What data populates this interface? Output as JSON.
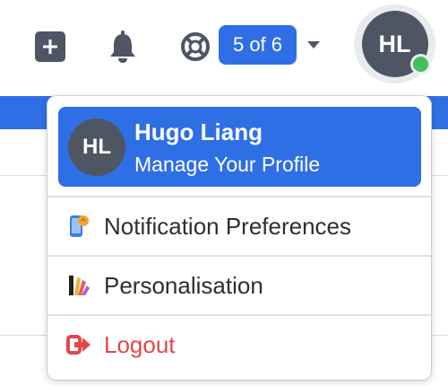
{
  "toolbar": {
    "add_icon": "plus-square-icon",
    "bell_icon": "bell-icon",
    "help_icon": "lifebuoy-icon",
    "counter_label": "5 of 6",
    "caret_icon": "caret-down-icon"
  },
  "user": {
    "initials": "HL",
    "status": "online",
    "status_color": "#42c05a"
  },
  "dropdown": {
    "profile": {
      "initials": "HL",
      "name": "Hugo Liang",
      "subtitle": "Manage Your Profile"
    },
    "items": [
      {
        "label": "Notification Preferences",
        "icon": "phone-notification-icon"
      },
      {
        "label": "Personalisation",
        "icon": "palette-swatch-icon"
      },
      {
        "label": "Logout",
        "icon": "logout-icon",
        "color": "#e0484b"
      }
    ]
  },
  "colors": {
    "accent": "#2f6fe6",
    "dark_gray": "#4f5663",
    "danger": "#e0484b"
  }
}
